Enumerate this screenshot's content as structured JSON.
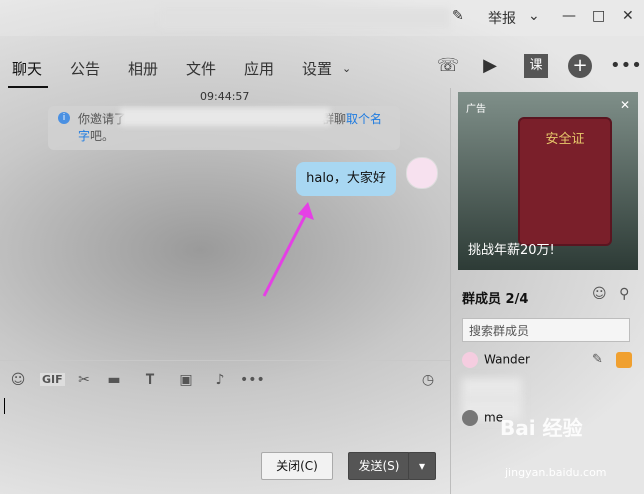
{
  "titlebar": {
    "report_label": "举报",
    "edit_icon": "pencil-icon",
    "chevron_icon": "chevron-down-icon",
    "min_icon": "minimize-icon",
    "max_icon": "maximize-icon",
    "close_icon": "close-icon"
  },
  "tabs": [
    {
      "label": "聊天"
    },
    {
      "label": "公告"
    },
    {
      "label": "相册"
    },
    {
      "label": "文件"
    },
    {
      "label": "应用"
    },
    {
      "label": "设置"
    }
  ],
  "top_icons": [
    "phone-icon",
    "video-icon",
    "class-icon",
    "add-icon",
    "more-icon"
  ],
  "chat": {
    "time": "09:44:57",
    "system_prefix": "你邀请了",
    "system_suffix": "群聊",
    "system_link": "取个名",
    "system_link2": "字",
    "system_tail": "吧。",
    "message": "halo，大家好"
  },
  "toolbar": {
    "gif_label": "GIF",
    "icons": [
      "emoji-icon",
      "gif-icon",
      "scissors-icon",
      "folder-icon",
      "font-icon",
      "image-icon",
      "bell-icon",
      "more-icon",
      "clock-icon"
    ]
  },
  "buttons": {
    "close": "关闭(C)",
    "send": "发送(S)",
    "send_arrow": "▾"
  },
  "ad": {
    "label": "广告",
    "close": "✕",
    "book_title": "安全证",
    "caption": "挑战年薪20万!"
  },
  "members": {
    "title": "群成员 2/4",
    "search_placeholder": "搜索群成员",
    "list": [
      {
        "name": "Wander"
      },
      {
        "name": "me"
      }
    ]
  },
  "watermark": {
    "main": "Bai 经验",
    "url": "jingyan.baidu.com"
  },
  "colors": {
    "bubble": "#a8d7f2",
    "link": "#1e7be0",
    "arrow": "#e540e5"
  }
}
